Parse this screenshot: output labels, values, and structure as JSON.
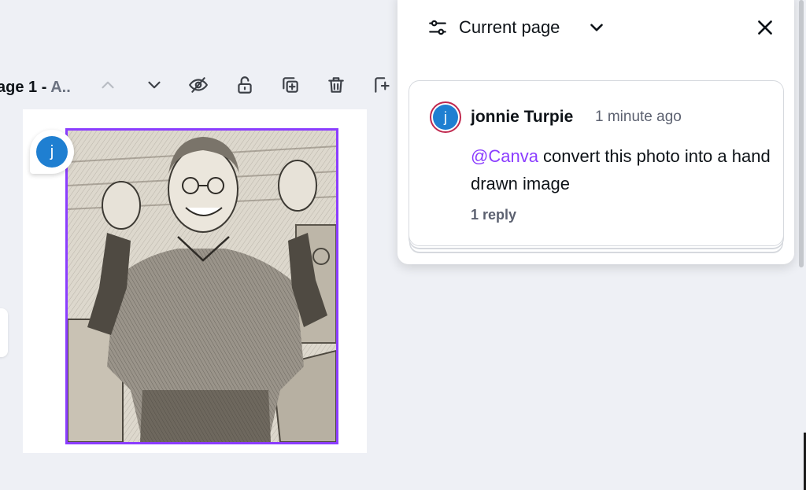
{
  "toolbar": {
    "page_label": "age 1 - ",
    "page_label_suffix": "A..",
    "icons": [
      "chevron-up-icon",
      "chevron-down-icon",
      "eye-hidden-icon",
      "lock-open-icon",
      "duplicate-icon",
      "trash-icon",
      "add-page-icon"
    ]
  },
  "canvas": {
    "pin_avatar_letter": "j",
    "selection_color": "#8b3dff"
  },
  "comments_panel": {
    "filter_label": "Current page",
    "comment": {
      "avatar_letter": "j",
      "author": "jonnie Turpie",
      "timestamp": "1 minute ago",
      "mention": "@Canva",
      "text": " convert this photo into a hand drawn image",
      "replies": "1 reply"
    }
  },
  "colors": {
    "accent": "#8b3dff",
    "avatar": "#1f7fd1",
    "avatar_ring": "#c0284e"
  }
}
